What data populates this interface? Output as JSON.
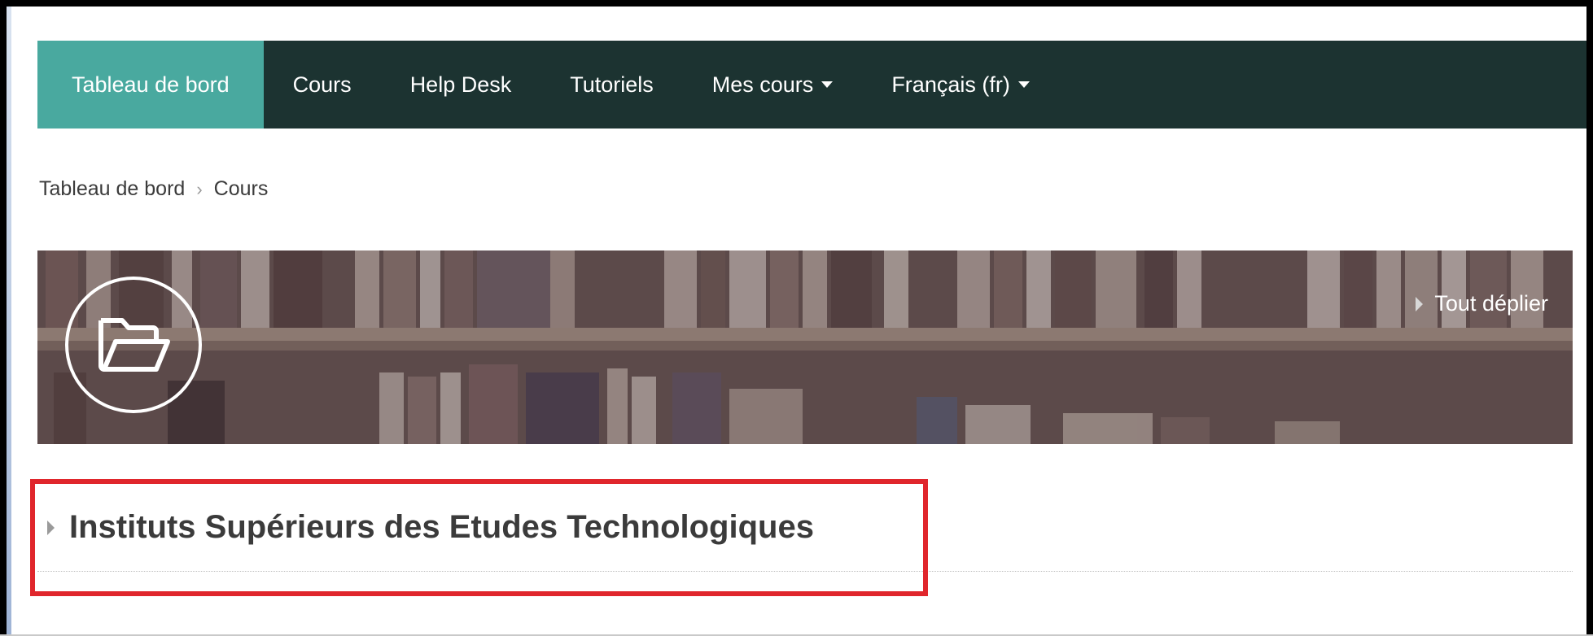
{
  "navbar": {
    "items": [
      {
        "label": "Tableau de bord",
        "active": true
      },
      {
        "label": "Cours"
      },
      {
        "label": "Help Desk"
      },
      {
        "label": "Tutoriels"
      },
      {
        "label": "Mes cours",
        "dropdown": true
      },
      {
        "label": "Français (fr)",
        "dropdown": true
      }
    ]
  },
  "breadcrumb": {
    "items": [
      "Tableau de bord",
      "Cours"
    ],
    "separator": "›"
  },
  "banner": {
    "icon": "folder-open-icon",
    "expand_all": "Tout déplier"
  },
  "category": {
    "title": "Instituts Supérieurs des Etudes Technologiques"
  },
  "colors": {
    "navbar_bg": "#1c3331",
    "navbar_active": "#49a99f",
    "highlight_border": "#e0262c"
  }
}
